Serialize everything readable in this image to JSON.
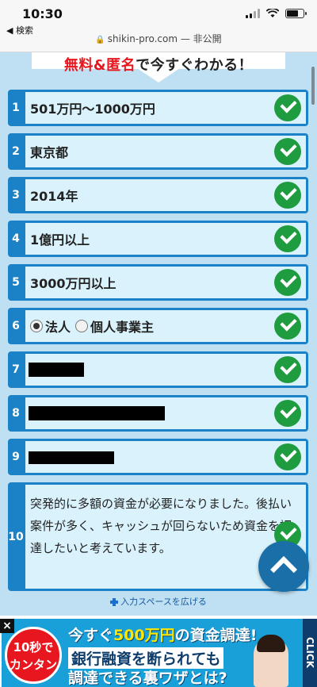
{
  "status_bar": {
    "time": "10:30",
    "back_label": "◀ 検索",
    "url": "shikin-pro.com",
    "url_suffix": " — 非公開"
  },
  "headline": {
    "part1": "無料",
    "amp": "&",
    "part2": "匿名",
    "rest": "で今すぐわかる！"
  },
  "rows": [
    {
      "num": "1",
      "text": "501万円〜1000万円"
    },
    {
      "num": "2",
      "text": "東京都"
    },
    {
      "num": "3",
      "text": "2014年"
    },
    {
      "num": "4",
      "text": "1億円以上"
    },
    {
      "num": "5",
      "text": "3000万円以上"
    },
    {
      "num": "6",
      "option_a": "法人",
      "option_b": "個人事業主",
      "selected": "法人"
    },
    {
      "num": "7"
    },
    {
      "num": "8"
    },
    {
      "num": "9"
    },
    {
      "num": "10",
      "text": "突発的に多額の資金が必要になりました。後払い案件が多く、キャッシュが回らないため資金を調達したいと考えています。"
    }
  ],
  "expand_label": "入力スペースを広げる",
  "ad": {
    "close": "×",
    "badge_line1": "10秒で",
    "badge_line2": "カンタン",
    "line1_pre": "今すぐ",
    "line1_amount": "500万円",
    "line1_post": "の資金調達!",
    "line2": "銀行融資を断られても",
    "line3": "調達できる裏ワザとは?",
    "cta": "CLICK"
  },
  "colors": {
    "row_border": "#1c82c7",
    "row_fill": "#d9f2fc",
    "check": "#1f9c3f",
    "accent_red": "#e8171f",
    "fab": "#1a6fa8"
  },
  "icons": [
    "back-arrow-icon",
    "signal-icon",
    "wifi-icon",
    "battery-icon",
    "lock-icon",
    "check-icon",
    "chevron-up-icon",
    "plus-icon",
    "close-icon"
  ]
}
